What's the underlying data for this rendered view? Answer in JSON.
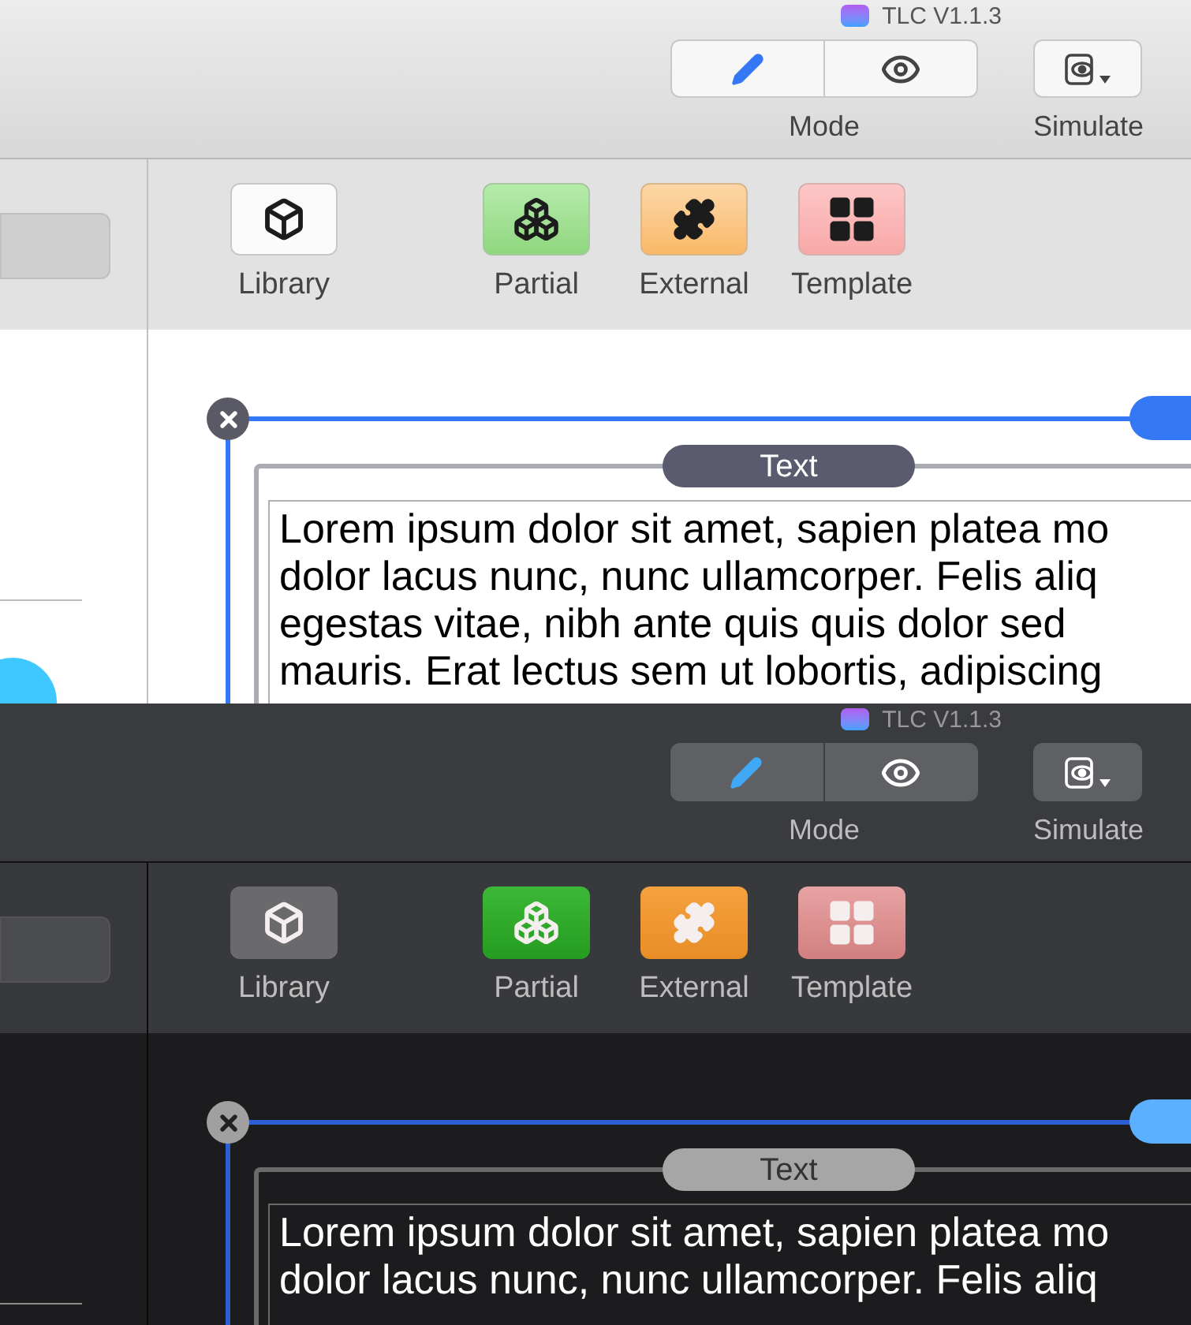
{
  "panels": [
    {
      "kind": "light",
      "title": "TLC V1.1.3",
      "mode": {
        "label": "Mode",
        "options": [
          {
            "kind": "edit",
            "selected": true
          },
          {
            "kind": "preview",
            "selected": false
          }
        ]
      },
      "simulate": {
        "label": "Simulate"
      },
      "tools": [
        {
          "kind": "library",
          "label": "Library"
        },
        {
          "kind": "partial",
          "label": "Partial"
        },
        {
          "kind": "external",
          "label": "External"
        },
        {
          "kind": "template",
          "label": "Template"
        }
      ],
      "component": {
        "label": "Text",
        "lines": [
          "Lorem ipsum dolor sit amet, sapien platea mo",
          "dolor lacus nunc, nunc ullamcorper. Felis aliq",
          "egestas vitae, nibh ante quis quis dolor sed",
          "mauris. Erat lectus sem ut lobortis, adipiscing"
        ]
      }
    },
    {
      "kind": "dark",
      "title": "TLC V1.1.3",
      "mode": {
        "label": "Mode",
        "options": [
          {
            "kind": "edit",
            "selected": true
          },
          {
            "kind": "preview",
            "selected": false
          }
        ]
      },
      "simulate": {
        "label": "Simulate"
      },
      "tools": [
        {
          "kind": "library",
          "label": "Library"
        },
        {
          "kind": "partial",
          "label": "Partial"
        },
        {
          "kind": "external",
          "label": "External"
        },
        {
          "kind": "template",
          "label": "Template"
        }
      ],
      "component": {
        "label": "Text",
        "lines": [
          "Lorem ipsum dolor sit amet, sapien platea mo",
          "dolor lacus nunc, nunc ullamcorper. Felis aliq"
        ]
      }
    }
  ]
}
